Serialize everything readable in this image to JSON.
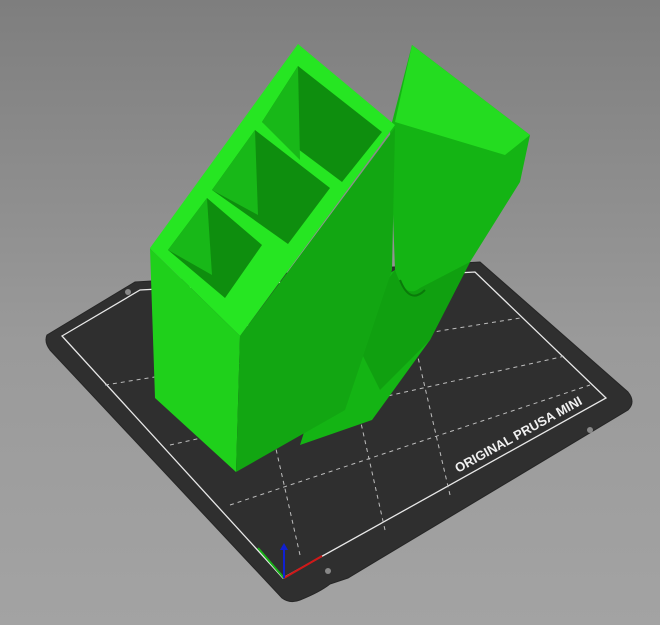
{
  "viewport": {
    "bed_label": "ORIGINAL PRUSA MINI",
    "colors": {
      "background": "#8c8c8c",
      "bed": "#2e2e2e",
      "model_light": "#22e01e",
      "model_mid": "#14b014",
      "model_dark": "#0c8c0c",
      "axis_x": "#d01818",
      "axis_y": "#18b018",
      "axis_z": "#1020d0"
    }
  }
}
